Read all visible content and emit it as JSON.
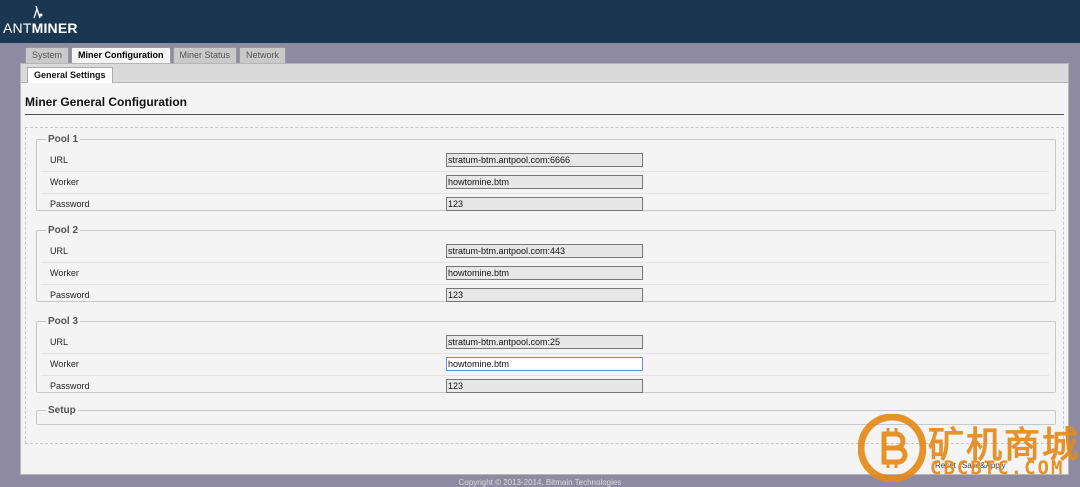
{
  "header": {
    "logo_ant": "ANT",
    "logo_miner": "MINER"
  },
  "tabs": [
    {
      "label": "System"
    },
    {
      "label": "Miner Configuration"
    },
    {
      "label": "Miner Status"
    },
    {
      "label": "Network"
    }
  ],
  "subtab": {
    "label": "General Settings"
  },
  "page_title": "Miner General Configuration",
  "pools": [
    {
      "legend": "Pool 1",
      "url_label": "URL",
      "url": "stratum-btm.antpool.com:6666",
      "worker_label": "Worker",
      "worker": "howtomine.btm",
      "password_label": "Password",
      "password": "123"
    },
    {
      "legend": "Pool 2",
      "url_label": "URL",
      "url": "stratum-btm.antpool.com:443",
      "worker_label": "Worker",
      "worker": "howtomine.btm",
      "password_label": "Password",
      "password": "123"
    },
    {
      "legend": "Pool 3",
      "url_label": "URL",
      "url": "stratum-btm.antpool.com:25",
      "worker_label": "Worker",
      "worker": "howtomine.btm",
      "password_label": "Password",
      "password": "123"
    }
  ],
  "setup_legend": "Setup",
  "buttons": {
    "reset": "Reset",
    "save": "Save&Apply"
  },
  "footer": "Copyright © 2013-2014, Bitmain Technologies",
  "watermark": {
    "text": "矿机商城",
    "sub": "CBCBTC.COM"
  },
  "colors": {
    "header_bg": "#1a3651",
    "page_bg": "#8e8aa2",
    "watermark": "#e58a1a"
  }
}
